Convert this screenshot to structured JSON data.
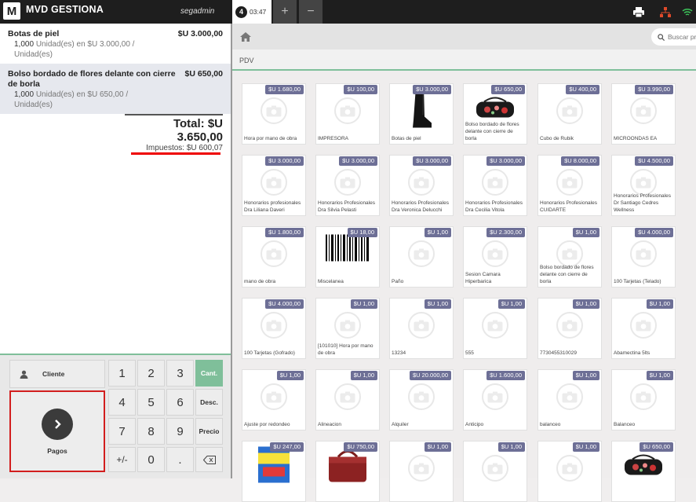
{
  "topbar": {
    "logo": "M",
    "app_name": "MVD GESTIONA",
    "username": "segadmin",
    "tab": {
      "number": "4",
      "time": "03:47"
    },
    "add_tab": "+",
    "remove_tab": "−"
  },
  "ticket": {
    "lines": [
      {
        "name": "Botas de piel",
        "qty": "1,000",
        "detail": "Unidad(es) en $U 3.000,00 / Unidad(es)",
        "price": "$U 3.000,00"
      },
      {
        "name": "Bolso bordado de flores delante con cierre de borla",
        "qty": "1,000",
        "detail": "Unidad(es) en $U 650,00 / Unidad(es)",
        "price": "$U 650,00"
      }
    ],
    "total": "Total: $U 3.650,00",
    "taxes": "Impuestos: $U 600,07"
  },
  "keypad": {
    "customer": "Cliente",
    "payments": "Pagos",
    "keys": [
      "1",
      "2",
      "3",
      "4",
      "5",
      "6",
      "7",
      "8",
      "9",
      "+/-",
      "0",
      "."
    ],
    "qty": "Cant.",
    "discount": "Desc.",
    "price": "Precio"
  },
  "toolbar": {
    "search_placeholder": "Buscar productos"
  },
  "breadcrumb": "PDV",
  "products": [
    {
      "price": "$U 1.680,00",
      "name": "Hora por mano de obra",
      "img": "none"
    },
    {
      "price": "$U 100,00",
      "name": "IMPRESORA",
      "img": "none"
    },
    {
      "price": "$U 3.000,00",
      "name": "Botas de piel",
      "img": "boot"
    },
    {
      "price": "$U 650,00",
      "name": "Bolso bordado de flores delante con cierre de borla",
      "img": "bag"
    },
    {
      "price": "$U 400,00",
      "name": "Cubo de Rubik",
      "img": "none"
    },
    {
      "price": "$U 3.990,00",
      "name": "MICROONDAS EA",
      "img": "none"
    },
    {
      "price": "$U 3.000,00",
      "name": "Honorarios profesionales Dra Liliana Daveri",
      "img": "none"
    },
    {
      "price": "$U 3.000,00",
      "name": "Honorarios Profesionales Dra Silvia Pelasti",
      "img": "none"
    },
    {
      "price": "$U 3.000,00",
      "name": "Honorarios Profesionales Dra Veronica Delucchi",
      "img": "none"
    },
    {
      "price": "$U 3.000,00",
      "name": "Honorarios Profesionales Dra Cecilia Vitola",
      "img": "none"
    },
    {
      "price": "$U 8.000,00",
      "name": "Honorarios Profesionales CUIDARTE",
      "img": "none"
    },
    {
      "price": "$U 4.500,00",
      "name": "Honorarios Profesionales Dr Santiago Cedres Wellness",
      "img": "none"
    },
    {
      "price": "$U 1.800,00",
      "name": "mano de obra",
      "img": "none"
    },
    {
      "price": "$U 18,00",
      "name": "Miscelanea",
      "img": "barcode"
    },
    {
      "price": "$U 1,00",
      "name": "Paño",
      "img": "none"
    },
    {
      "price": "$U 2.300,00",
      "name": "Sesion Camara Hiperbarica",
      "img": "none"
    },
    {
      "price": "$U 1,00",
      "name": "Bolso bordado de flores delante con cierre de borla",
      "img": "none"
    },
    {
      "price": "$U 4.000,00",
      "name": "100 Tarjetas (Telado)",
      "img": "none"
    },
    {
      "price": "$U 4.000,00",
      "name": "100 Tarjetas (Gofrado)",
      "img": "none"
    },
    {
      "price": "$U 1,00",
      "name": "[101010] Hora por mano de obra",
      "img": "none"
    },
    {
      "price": "$U 1,00",
      "name": "13234",
      "img": "none"
    },
    {
      "price": "$U 1,00",
      "name": "555",
      "img": "none"
    },
    {
      "price": "$U 1,00",
      "name": "7730455310029",
      "img": "none"
    },
    {
      "price": "$U 1,00",
      "name": "Abamectina 5lts",
      "img": "none"
    },
    {
      "price": "$U 1,00",
      "name": "Ajuste por redondeo",
      "img": "none"
    },
    {
      "price": "$U 1,00",
      "name": "Alineacion",
      "img": "none"
    },
    {
      "price": "$U 20.000,00",
      "name": "Alquiler",
      "img": "none"
    },
    {
      "price": "$U 1.600,00",
      "name": "Anticipo",
      "img": "none"
    },
    {
      "price": "$U 1,00",
      "name": "balanceo",
      "img": "none"
    },
    {
      "price": "$U 1,00",
      "name": "Balanceo",
      "img": "none"
    },
    {
      "price": "$U 247,00",
      "name": "",
      "img": "bioclin"
    },
    {
      "price": "$U 750,00",
      "name": "",
      "img": "redbag"
    },
    {
      "price": "$U 1,00",
      "name": "",
      "img": "none"
    },
    {
      "price": "$U 1,00",
      "name": "",
      "img": "none"
    },
    {
      "price": "$U 1,00",
      "name": "",
      "img": "none"
    },
    {
      "price": "$U 650,00",
      "name": "",
      "img": "bag"
    }
  ],
  "colors": {
    "accent_green": "#7fbf9a",
    "badge": "#6d6f96",
    "highlight_red": "#e00000"
  }
}
